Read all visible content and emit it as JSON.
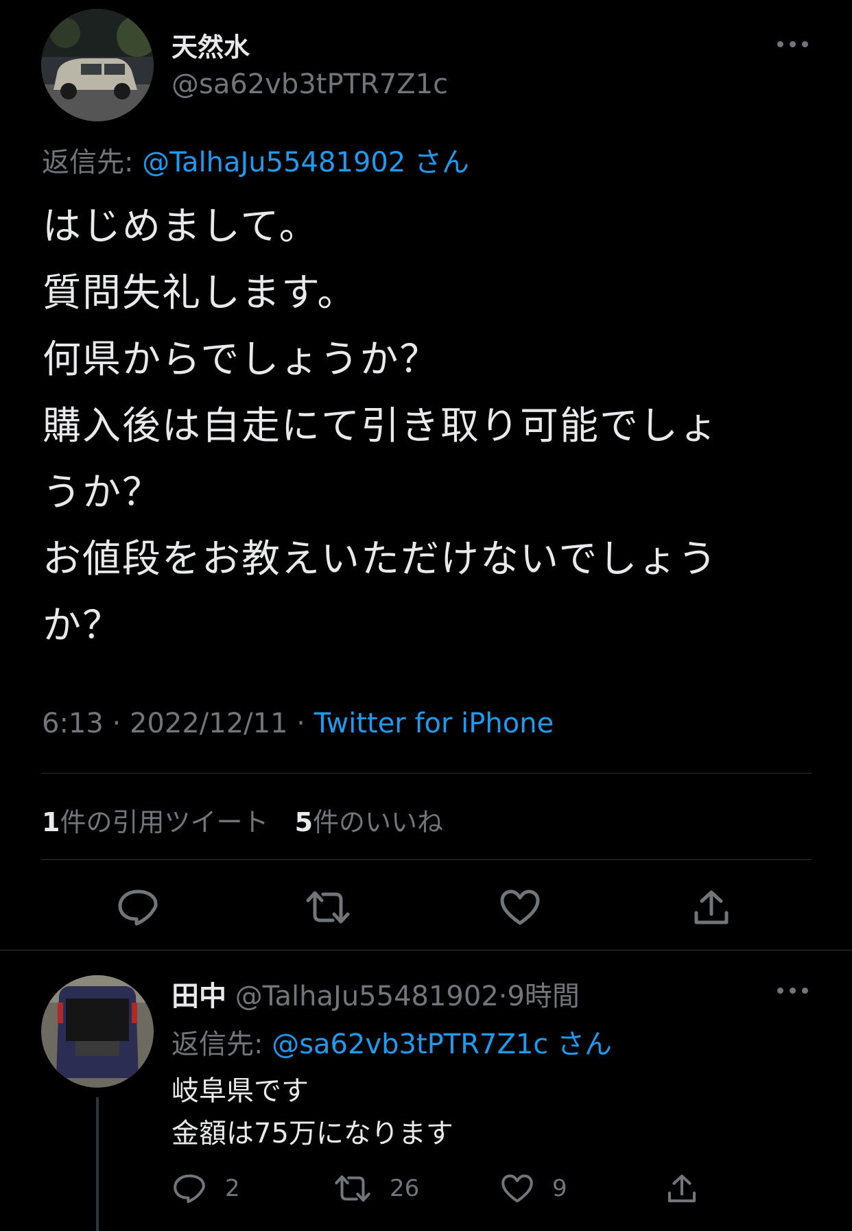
{
  "main_tweet": {
    "display_name": "天然水",
    "handle": "@sa62vb3tPTR7Z1c",
    "reply_prefix": "返信先:",
    "reply_to": "@TalhaJu55481902",
    "reply_suffix": "さん",
    "lines": [
      "はじめまして。",
      "質問失礼します。",
      "何県からでしょうか？",
      "購入後は自走にて引き取り可能でしょ",
      "うか？",
      "お値段をお教えいただけないでしょう",
      "か？"
    ],
    "time": "6:13",
    "sep1": "·",
    "date": "2022/12/11",
    "sep2": "·",
    "source": "Twitter for iPhone",
    "quote_count": "1",
    "quote_label": "件の引用ツイート",
    "like_count": "5",
    "like_label": "件のいいね",
    "actions": {
      "reply": "reply-icon",
      "retweet": "retweet-icon",
      "like": "heart-icon",
      "share": "share-icon"
    }
  },
  "reply_tweet": {
    "display_name": "田中",
    "handle": "@TalhaJu55481902",
    "sep": "·",
    "time_ago": "9時間",
    "reply_prefix": "返信先:",
    "reply_to": "@sa62vb3tPTR7Z1c",
    "reply_suffix": "さん",
    "lines": [
      "岐阜県です",
      "金額は75万になります"
    ],
    "reply_count": "2",
    "retweet_count": "26",
    "like_count": "9"
  },
  "colors": {
    "background": "#000000",
    "text": "#e7e9ea",
    "secondary": "#71767b",
    "link": "#1d9bf0",
    "divider": "#2f3336"
  }
}
